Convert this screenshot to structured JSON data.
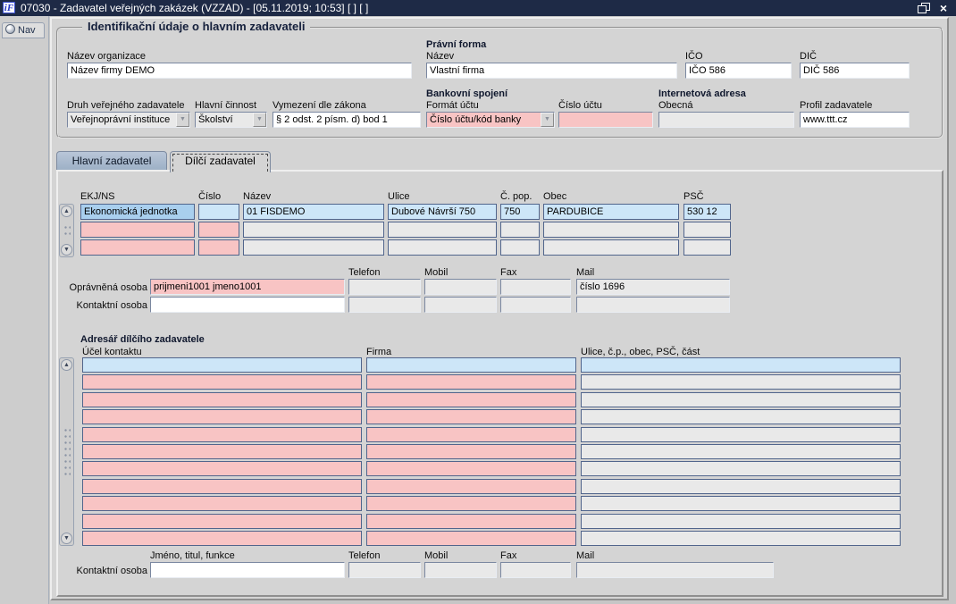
{
  "window": {
    "title": "07030 - Zadavatel veřejných zakázek (VZZAD) - [05.11.2019; 10:53]  [ ]  [ ]",
    "icon": "iF",
    "close_glyph": "×"
  },
  "nav": {
    "label": "Nav"
  },
  "identification": {
    "legend": "Identifikační údaje o hlavním zadavateli",
    "nazev_organizace_label": "Název organizace",
    "nazev_organizace_value": "Název firmy DEMO",
    "pravni_forma_group": "Právní forma",
    "pravni_forma_label": "Název",
    "pravni_forma_value": "Vlastní firma",
    "ico_label": "IČO",
    "ico_value": "IČO 586",
    "dic_label": "DIČ",
    "dic_value": "DIČ 586",
    "druh_label": "Druh veřejného zadavatele",
    "druh_value": "Veřejnoprávní instituce",
    "cinnost_label": "Hlavní činnost",
    "cinnost_value": "Školství",
    "vymezeni_label": "Vymezení dle zákona",
    "vymezeni_value": "§ 2 odst. 2 písm. d) bod 1",
    "bank_group": "Bankovní spojení",
    "format_uctu_label": "Formát účtu",
    "format_uctu_value": "Číslo účtu/kód banky",
    "cislo_uctu_label": "Číslo účtu",
    "cislo_uctu_value": "",
    "internet_group": "Internetová adresa",
    "obecna_label": "Obecná",
    "obecna_value": "",
    "profil_label": "Profil zadavatele",
    "profil_value": "www.ttt.cz"
  },
  "tabs": [
    {
      "label": "Hlavní zadavatel",
      "active": false
    },
    {
      "label": "Dílčí zadavatel",
      "active": true
    }
  ],
  "unit_table": {
    "headers": [
      "EKJ/NS",
      "Číslo",
      "Název",
      "Ulice",
      "Č. pop.",
      "Obec",
      "PSČ"
    ],
    "rows": [
      {
        "state": "selected",
        "cells": [
          "Ekonomická jednotka",
          "",
          "01 FISDEMO",
          "Dubové Návrší 750",
          "750",
          "PARDUBICE",
          "530 12"
        ]
      },
      {
        "state": "required",
        "cells": [
          "",
          "",
          "",
          "",
          "",
          "",
          ""
        ]
      },
      {
        "state": "required",
        "cells": [
          "",
          "",
          "",
          "",
          "",
          "",
          ""
        ]
      }
    ]
  },
  "contact_section": {
    "col_headers": [
      "Telefon",
      "Mobil",
      "Fax",
      "Mail"
    ],
    "rows": [
      {
        "label": "Oprávněná osoba",
        "name": "prijmeni1001 jmeno1001",
        "name_style": "pink",
        "telefon": "",
        "mobil": "",
        "fax": "",
        "mail": "číslo 1696"
      },
      {
        "label": "Kontaktní osoba",
        "name": "",
        "name_style": "white",
        "telefon": "",
        "mobil": "",
        "fax": "",
        "mail": ""
      }
    ]
  },
  "address_book": {
    "title": "Adresář dílčího zadavatele",
    "headers": [
      "Účel kontaktu",
      "Firma",
      "Ulice, č.p., obec, PSČ, část"
    ],
    "row_count": 11,
    "selected_row": 0,
    "rows_empty": true
  },
  "bottom_contact": {
    "label": "Kontaktní osoba",
    "name_header": "Jméno, titul, funkce",
    "col_headers": [
      "Telefon",
      "Mobil",
      "Fax",
      "Mail"
    ],
    "name": "",
    "telefon": "",
    "mobil": "",
    "fax": "",
    "mail": ""
  },
  "colors": {
    "titlebar": "#1e2a46",
    "window_bg": "#d4d4d4",
    "required_pink": "#f8c4c4",
    "selected_blue": "#cde6f8",
    "focused_blue": "#a9cfee",
    "readonly_grey": "#e9e9e9",
    "tab_inactive": "#a8b9cf",
    "cell_border": "#51658c"
  }
}
